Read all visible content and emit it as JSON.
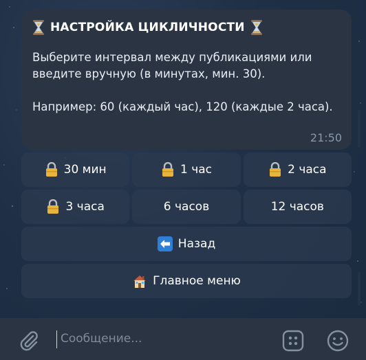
{
  "message": {
    "title": "НАСТРОЙКА ЦИКЛИЧНОСТИ",
    "body_line1": "Выберите интервал между публикациями или введите вручную (в минутах, мин. 30).",
    "body_line2": "Например: 60 (каждый час), 120 (каждые 2 часа).",
    "time": "21:50",
    "title_icon": "hourglass-icon"
  },
  "keyboard": {
    "rows": [
      [
        {
          "label": "30 мин",
          "icon": "lock-icon"
        },
        {
          "label": "1 час",
          "icon": "lock-icon"
        },
        {
          "label": "2 часа",
          "icon": "lock-icon"
        }
      ],
      [
        {
          "label": "3 часа",
          "icon": "lock-icon"
        },
        {
          "label": "6 часов",
          "icon": ""
        },
        {
          "label": "12 часов",
          "icon": ""
        }
      ],
      [
        {
          "label": "Назад",
          "icon": "back-arrow-icon"
        }
      ],
      [
        {
          "label": "Главное меню",
          "icon": "house-icon"
        }
      ]
    ]
  },
  "composer": {
    "placeholder": "Сообщение..."
  },
  "colors": {
    "background": "#1f2f45",
    "bubble": "#2b3442",
    "button": "#2c3a4e",
    "time": "#8a97a8",
    "back_icon_blue": "#2f7fd6"
  }
}
